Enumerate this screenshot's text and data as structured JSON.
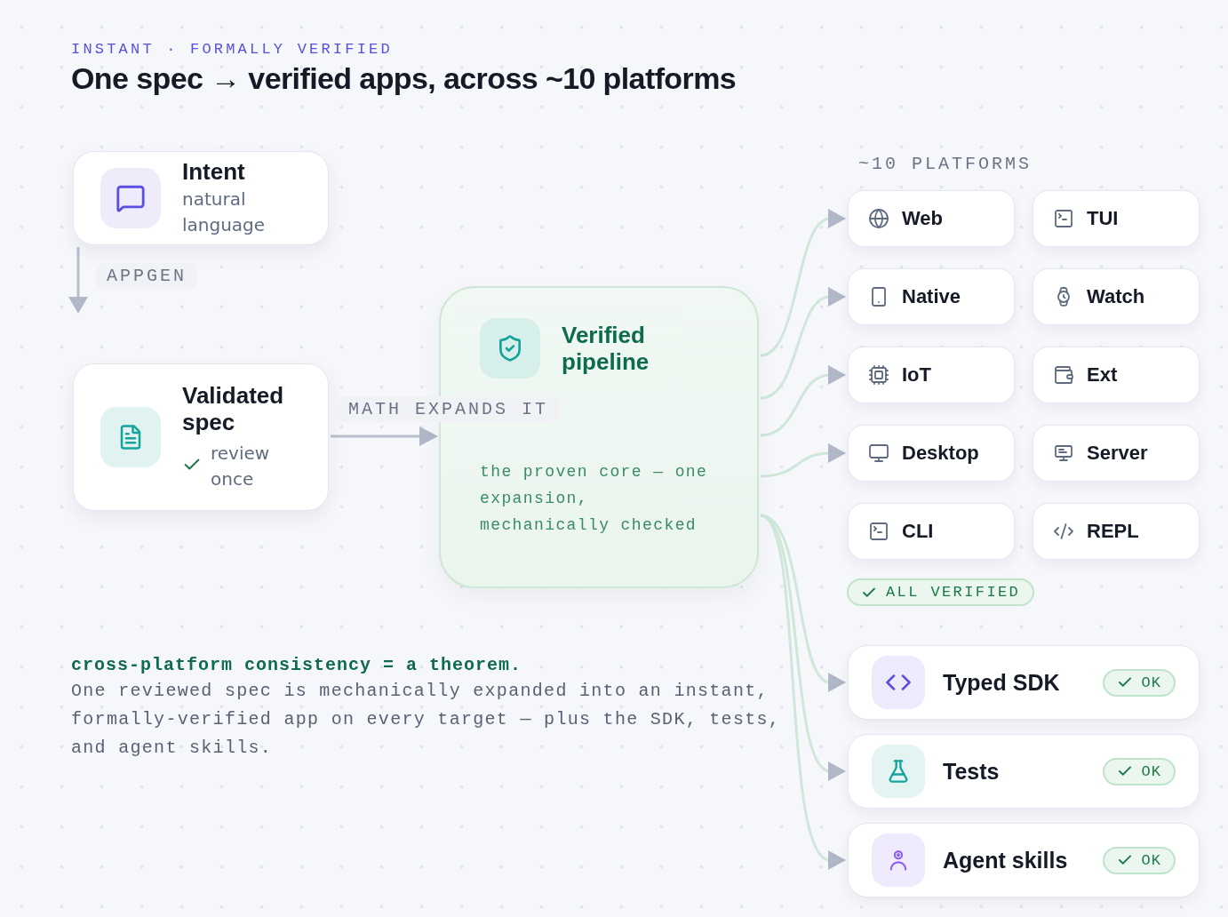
{
  "eyebrow": "INSTANT · FORMALLY VERIFIED",
  "title": "One spec → verified apps, across ~10 platforms",
  "intent": {
    "title": "Intent",
    "subtitle": "natural language"
  },
  "appgen_label": "APPGEN",
  "spec": {
    "title": "Validated spec",
    "note": "review once"
  },
  "expand_label": "MATH EXPANDS IT",
  "pipeline": {
    "title": "Verified pipeline",
    "description": "the proven core — one expansion, mechanically checked"
  },
  "platforms_heading": "~10 PLATFORMS",
  "platforms": [
    {
      "label": "Web",
      "kind": "globe",
      "linked": true
    },
    {
      "label": "TUI",
      "kind": "terminal",
      "linked": false
    },
    {
      "label": "Native",
      "kind": "phone",
      "linked": true
    },
    {
      "label": "Watch",
      "kind": "watch",
      "linked": false
    },
    {
      "label": "IoT",
      "kind": "chip",
      "linked": true
    },
    {
      "label": "Ext",
      "kind": "wallet",
      "linked": false
    },
    {
      "label": "Desktop",
      "kind": "monitor",
      "linked": true
    },
    {
      "label": "Server",
      "kind": "server",
      "linked": false
    },
    {
      "label": "CLI",
      "kind": "terminal",
      "linked": false
    },
    {
      "label": "REPL",
      "kind": "code",
      "linked": false
    }
  ],
  "verified_badge": "ALL VERIFIED",
  "outputs": [
    {
      "label": "Typed SDK",
      "kind": "brackets",
      "status": "OK"
    },
    {
      "label": "Tests",
      "kind": "flask",
      "status": "OK"
    },
    {
      "label": "Agent skills",
      "kind": "person",
      "status": "OK"
    }
  ],
  "footer": {
    "headline": "cross-platform consistency = a theorem.",
    "body": "One reviewed spec is mechanically expanded into an instant, formally-verified app on every target — plus the SDK, tests, and agent skills."
  }
}
